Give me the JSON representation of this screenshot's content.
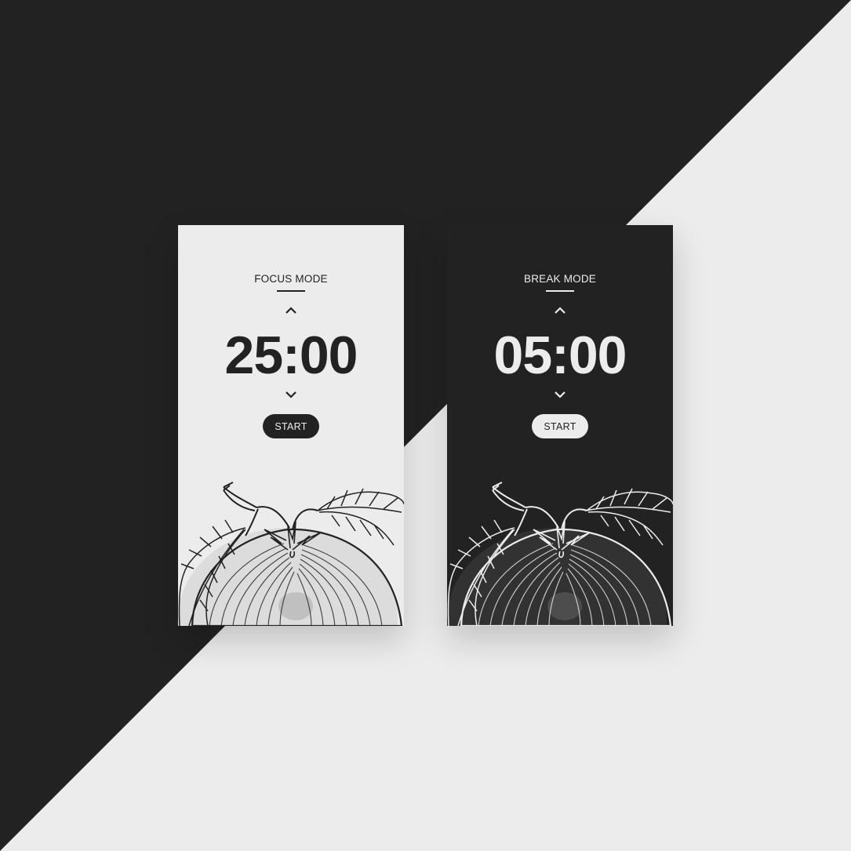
{
  "colors": {
    "dark": "#222222",
    "light": "#ececec"
  },
  "cards": [
    {
      "mode_label": "FOCUS MODE",
      "time": "25:00",
      "start_label": "START",
      "theme": "light"
    },
    {
      "mode_label": "BREAK MODE",
      "time": "05:00",
      "start_label": "START",
      "theme": "dark"
    }
  ],
  "icons": {
    "increase": "chevron-up-icon",
    "decrease": "chevron-down-icon",
    "illustration": "tomato-illustration"
  }
}
